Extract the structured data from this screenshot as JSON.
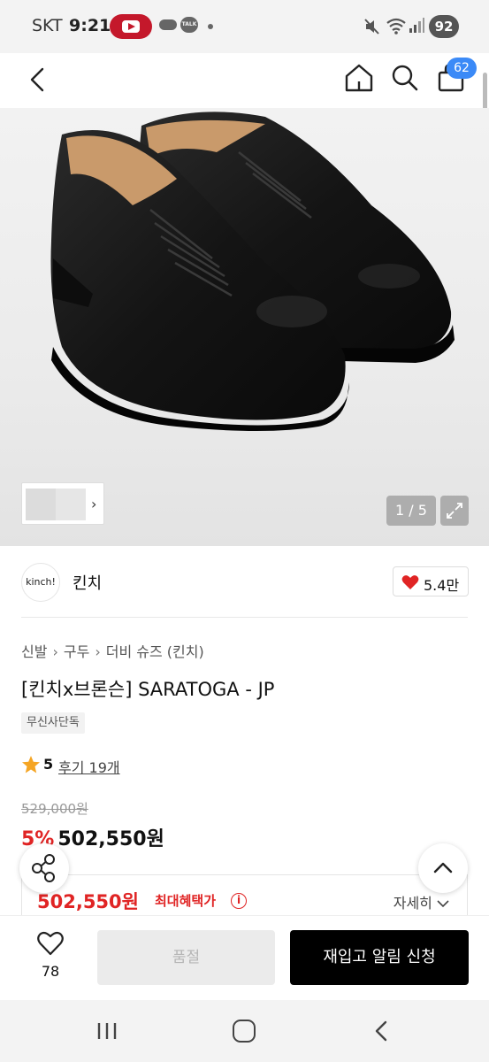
{
  "status_bar": {
    "carrier": "SKT",
    "time": "9:21",
    "talk_label": "TALK",
    "battery": "92"
  },
  "header": {
    "cart_count": "62"
  },
  "gallery": {
    "page_indicator": "1 / 5"
  },
  "brand": {
    "logo_text": "kinch!",
    "name": "킨치",
    "likes": "5.4만"
  },
  "product": {
    "breadcrumb": [
      "신발",
      "구두",
      "더비 슈즈 (킨치)"
    ],
    "title": "[킨치x브론슨] SARATOGA - JP",
    "exclusive_tag": "무신사단독",
    "rating": "5",
    "reviews_label": "후기 19개",
    "original_price": "529,000원",
    "discount": "5%",
    "sale_price": "502,550원"
  },
  "benefit": {
    "price": "502,550원",
    "label": "최대혜택가",
    "info_icon": "i",
    "detail_label": "자세히"
  },
  "bottom_bar": {
    "wish_count": "78",
    "soldout_label": "품절",
    "restock_label": "재입고 알림 신청"
  },
  "colors": {
    "accent_red": "#e02424",
    "badge_blue": "#3b8af7",
    "primary_button": "#000000"
  }
}
